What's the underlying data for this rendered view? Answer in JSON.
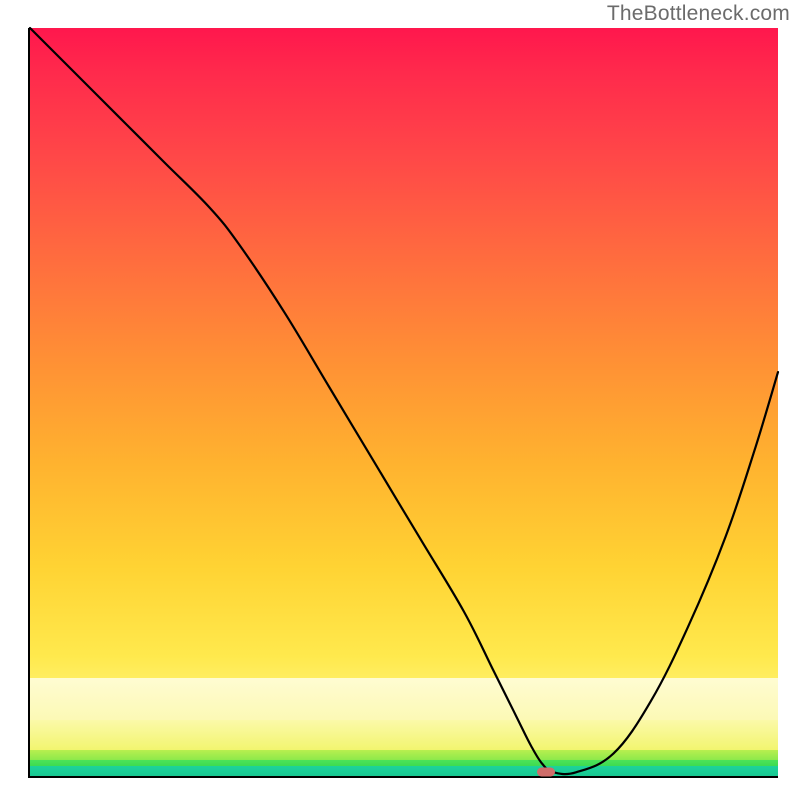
{
  "watermark": "TheBottleneck.com",
  "chart_data": {
    "type": "line",
    "title": "",
    "xlabel": "",
    "ylabel": "",
    "xlim": [
      0,
      100
    ],
    "ylim": [
      0,
      100
    ],
    "x": [
      0,
      6,
      12,
      18,
      24,
      28,
      34,
      40,
      46,
      52,
      58,
      62,
      65,
      67,
      68.5,
      70,
      73,
      78,
      83,
      88,
      93,
      97,
      100
    ],
    "values": [
      100,
      94,
      88,
      82,
      76,
      71,
      62,
      52,
      42,
      32,
      22,
      14,
      8,
      4,
      1.6,
      0.5,
      0.5,
      3,
      10,
      20,
      32,
      44,
      54
    ],
    "marker": {
      "x": 69,
      "y": 0.5
    },
    "background_bands": [
      {
        "color": "#ff174d",
        "from_pct": 0,
        "to_pct": 6
      },
      {
        "color": "#ff4748",
        "from_pct": 6,
        "to_pct": 30
      },
      {
        "color": "#ff8f35",
        "from_pct": 30,
        "to_pct": 58
      },
      {
        "color": "#ffd333",
        "from_pct": 58,
        "to_pct": 84
      },
      {
        "color": "#fffab5",
        "from_pct": 84,
        "to_pct": 92
      },
      {
        "color": "#fbf9a9",
        "from_pct": 92,
        "to_pct": 96
      },
      {
        "color": "#b8ef4f",
        "from_pct": 96,
        "to_pct": 97.5
      },
      {
        "color": "#4be35a",
        "from_pct": 97.5,
        "to_pct": 98.5
      },
      {
        "color": "#1dd39b",
        "from_pct": 98.5,
        "to_pct": 100
      }
    ]
  }
}
